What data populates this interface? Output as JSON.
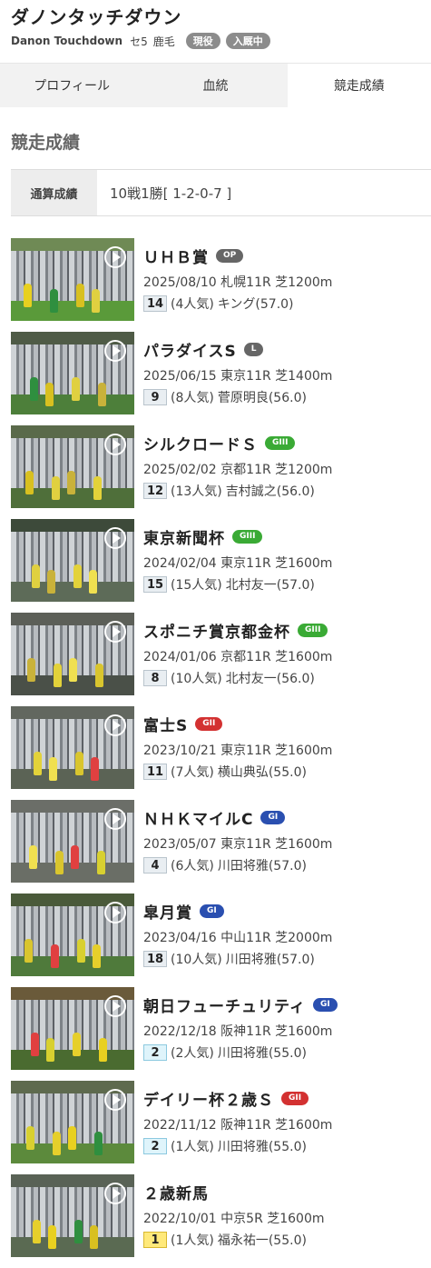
{
  "horse": {
    "name_jp": "ダノンタッチダウン",
    "name_en": "Danon Touchdown",
    "sex_age": "セ5",
    "coat": "鹿毛",
    "badges": [
      "現役",
      "入厩中"
    ]
  },
  "tabs": [
    {
      "label": "プロフィール",
      "active": false
    },
    {
      "label": "血統",
      "active": false
    },
    {
      "label": "競走成績",
      "active": true
    }
  ],
  "section_title": "競走成績",
  "summary": {
    "label": "通算成績",
    "value": "10戦1勝[ 1-2-0-7 ]"
  },
  "colors": {
    "op": "#666666",
    "l": "#666666",
    "g3": "#3aaa35",
    "g2": "#d33131",
    "g1": "#2a4fb0"
  },
  "races": [
    {
      "name": "ＵＨＢ賞",
      "grade": "OP",
      "grade_color": "#666666",
      "date": "2025/08/10",
      "course": "札幌11R 芝1200m",
      "position": "14",
      "popularity": "(4人気)",
      "jockey_weight": "キング(57.0)"
    },
    {
      "name": "パラダイスS",
      "grade": "L",
      "grade_color": "#666666",
      "date": "2025/06/15",
      "course": "東京11R 芝1400m",
      "position": "9",
      "popularity": "(8人気)",
      "jockey_weight": "菅原明良(56.0)"
    },
    {
      "name": "シルクロードＳ",
      "grade": "GIII",
      "grade_color": "#3aaa35",
      "date": "2025/02/02",
      "course": "京都11R 芝1200m",
      "position": "12",
      "popularity": "(13人気)",
      "jockey_weight": "吉村誠之(56.0)"
    },
    {
      "name": "東京新聞杯",
      "grade": "GIII",
      "grade_color": "#3aaa35",
      "date": "2024/02/04",
      "course": "東京11R 芝1600m",
      "position": "15",
      "popularity": "(15人気)",
      "jockey_weight": "北村友一(57.0)"
    },
    {
      "name": "スポニチ賞京都金杯",
      "grade": "GIII",
      "grade_color": "#3aaa35",
      "date": "2024/01/06",
      "course": "京都11R 芝1600m",
      "position": "8",
      "popularity": "(10人気)",
      "jockey_weight": "北村友一(56.0)"
    },
    {
      "name": "富士S",
      "grade": "GII",
      "grade_color": "#d33131",
      "date": "2023/10/21",
      "course": "東京11R 芝1600m",
      "position": "11",
      "popularity": "(7人気)",
      "jockey_weight": "横山典弘(55.0)"
    },
    {
      "name": "ＮＨＫマイルC",
      "grade": "GI",
      "grade_color": "#2a4fb0",
      "date": "2023/05/07",
      "course": "東京11R 芝1600m",
      "position": "4",
      "popularity": "(6人気)",
      "jockey_weight": "川田将雅(57.0)"
    },
    {
      "name": "皐月賞",
      "grade": "GI",
      "grade_color": "#2a4fb0",
      "date": "2023/04/16",
      "course": "中山11R 芝2000m",
      "position": "18",
      "popularity": "(10人気)",
      "jockey_weight": "川田将雅(57.0)"
    },
    {
      "name": "朝日フューチュリティ",
      "grade": "GI",
      "grade_color": "#2a4fb0",
      "date": "2022/12/18",
      "course": "阪神11R 芝1600m",
      "position": "2",
      "popularity": "(2人気)",
      "jockey_weight": "川田将雅(55.0)"
    },
    {
      "name": "デイリー杯２歳Ｓ",
      "grade": "GII",
      "grade_color": "#d33131",
      "date": "2022/11/12",
      "course": "阪神11R 芝1600m",
      "position": "2",
      "popularity": "(1人気)",
      "jockey_weight": "川田将雅(55.0)"
    },
    {
      "name": "２歳新馬",
      "grade": "",
      "grade_color": "",
      "date": "2022/10/01",
      "course": "中京5R 芝1600m",
      "position": "1",
      "popularity": "(1人気)",
      "jockey_weight": "福永祐一(55.0)"
    }
  ]
}
